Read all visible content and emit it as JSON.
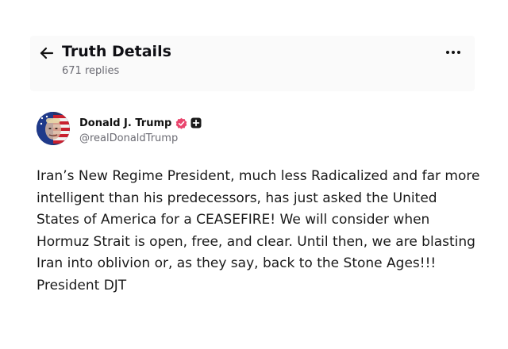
{
  "header": {
    "title": "Truth Details",
    "replies": "671 replies",
    "back_icon": "arrow-left-icon",
    "more_icon": "more-horizontal-icon"
  },
  "post": {
    "author": {
      "display_name": "Donald J. Trump",
      "handle": "@realDonaldTrump",
      "verified_icon": "verified-badge-icon",
      "plus_icon": "plus-badge-icon"
    },
    "body": "Iran’s New Regime President, much less Radicalized and far more intelligent than his predecessors, has just asked the United States of America for a CEASEFIRE! We will consider when Hormuz Strait is open, free, and clear. Until then, we are blasting Iran into oblivion or, as they say, back to the Stone Ages!!!\nPresident DJT"
  },
  "colors": {
    "verified_badge": "#e9456d",
    "title_text": "#0f0f14",
    "secondary_text": "#6b6b73",
    "header_background": "#fafafa"
  }
}
